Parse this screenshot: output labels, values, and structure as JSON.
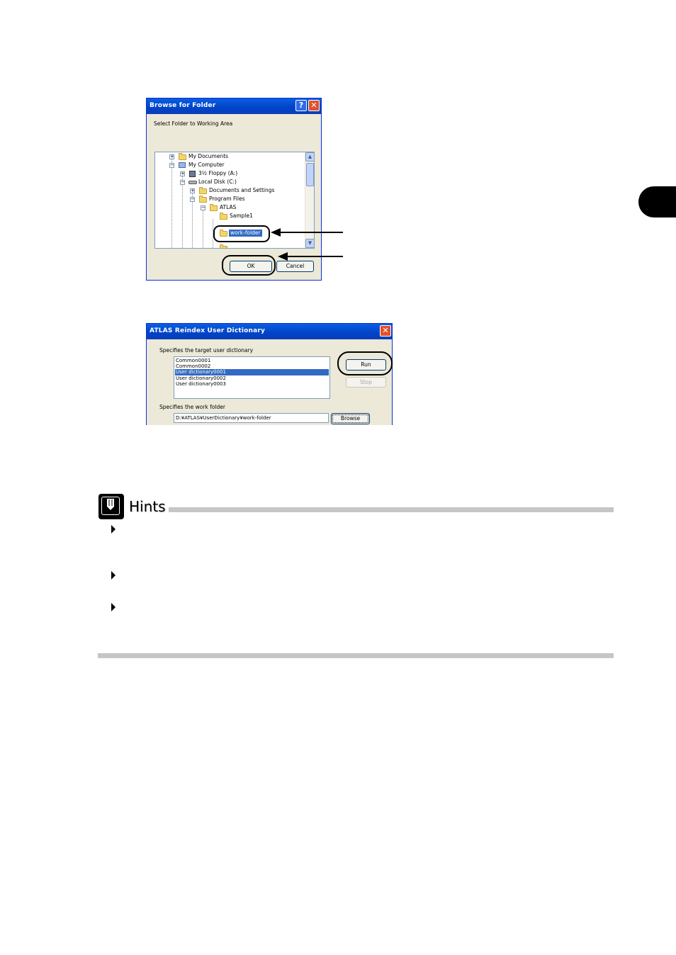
{
  "browse_dialog": {
    "title": "Browse for Folder",
    "help_button": "?",
    "close_button": "✕",
    "instruction": "Select Folder to Working Area",
    "tree": [
      {
        "label": "My Documents",
        "expander": "+"
      },
      {
        "label": "My Computer",
        "expander": "−"
      },
      {
        "label": "3½ Floppy (A:)",
        "expander": "+"
      },
      {
        "label": "Local Disk (C:)",
        "expander": "−"
      },
      {
        "label": "Documents and Settings",
        "expander": "+"
      },
      {
        "label": "Program Files",
        "expander": "−"
      },
      {
        "label": "ATLAS",
        "expander": "−"
      },
      {
        "label": "Sample1",
        "expander": ""
      },
      {
        "label": "work-folder",
        "expander": "",
        "selected": true
      }
    ],
    "ok_button": "OK",
    "cancel_button": "Cancel"
  },
  "reindex_dialog": {
    "title": "ATLAS Reindex User Dictionary",
    "close_button": "✕",
    "target_label": "Specifies the target user dictionary",
    "dictionaries": [
      {
        "name": "Common0001",
        "selected": false
      },
      {
        "name": "Common0002",
        "selected": false
      },
      {
        "name": "User dictionary0001",
        "selected": true
      },
      {
        "name": "User dictionary0002",
        "selected": false
      },
      {
        "name": "User dictionary0003",
        "selected": false
      }
    ],
    "run_button": "Run",
    "stop_button": "Stop",
    "work_folder_label": "Specifies the work folder",
    "work_folder_value": "D:¥ATLAS¥UserDictionary¥work-folder",
    "browse_button": "Browse"
  },
  "hints": {
    "title": "Hints"
  },
  "colors": {
    "xp_title_blue": "#0a5ee0",
    "selection_blue": "#316ac5",
    "dialog_face": "#ece9d8",
    "rule_gray": "#c6c6c6"
  }
}
